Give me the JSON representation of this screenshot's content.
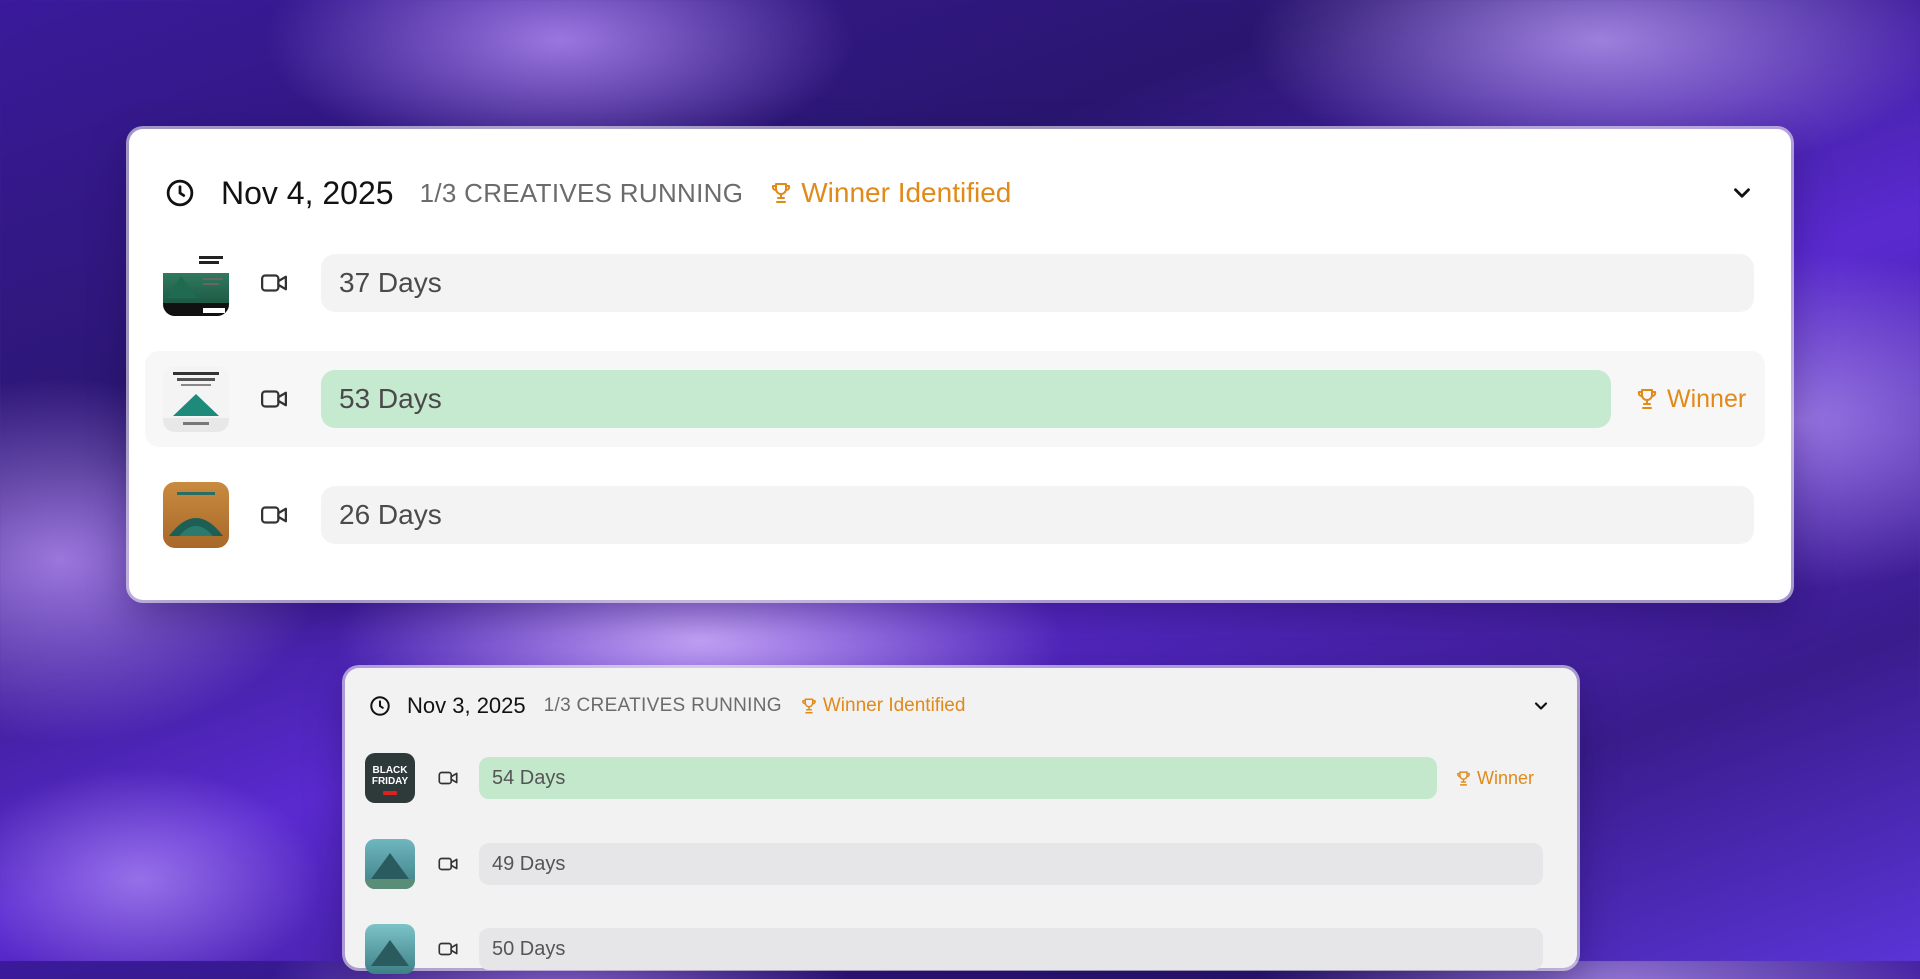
{
  "groups": [
    {
      "date": "Nov 4, 2025",
      "running": "1/3 CREATIVES RUNNING",
      "status": "Winner Identified",
      "rows": [
        {
          "days": "37 Days",
          "winner": false,
          "thumb": "green-tent-ad"
        },
        {
          "days": "53 Days",
          "winner": true,
          "winner_label": "Winner",
          "thumb": "white-tent-ad"
        },
        {
          "days": "26 Days",
          "winner": false,
          "thumb": "tent-on-wood"
        }
      ]
    },
    {
      "date": "Nov 3, 2025",
      "running": "1/3 CREATIVES RUNNING",
      "status": "Winner Identified",
      "rows": [
        {
          "days": "54 Days",
          "winner": true,
          "winner_label": "Winner",
          "thumb": "black-friday-ad"
        },
        {
          "days": "49 Days",
          "winner": false,
          "thumb": "teal-tent"
        },
        {
          "days": "50 Days",
          "winner": false,
          "thumb": "teal-tent-2"
        }
      ]
    }
  ],
  "colors": {
    "accent": "#e08a1a",
    "winner_bar": "#c6ead0",
    "bar": "#f3f3f4"
  },
  "icons": [
    "clock-icon",
    "video-camera-icon",
    "trophy-icon",
    "chevron-down-icon"
  ]
}
